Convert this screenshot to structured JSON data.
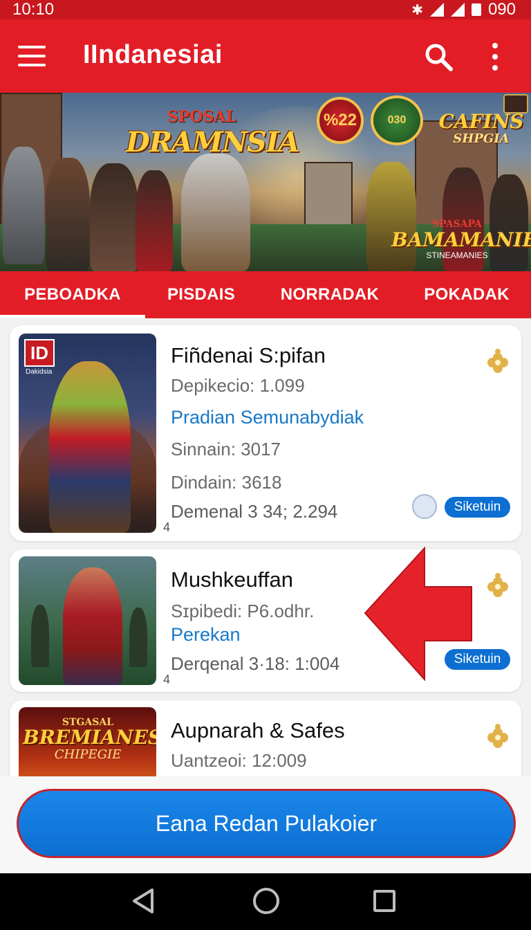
{
  "status_bar": {
    "time": "10:10",
    "battery_text": "090"
  },
  "app_bar": {
    "title": "IIndanesiai"
  },
  "banner": {
    "logo_left_small": "SPOSAL",
    "logo_left_big": "DRAMNSIA",
    "badge_red_text": "%22",
    "badge_green_text": "030",
    "logo_right_big": "CAFINS",
    "logo_right_small": "SHPGIA",
    "logo_bottom_small": "SPASAPA",
    "logo_bottom_big": "BAMAMANIES",
    "logo_bottom_tag": "STINEAMANIES"
  },
  "tabs": [
    {
      "label": "PEBOADKA",
      "active": true
    },
    {
      "label": "PISDAIS",
      "active": false
    },
    {
      "label": "NORRADAK",
      "active": false
    },
    {
      "label": "POKADAK",
      "active": false
    }
  ],
  "cards": [
    {
      "thumb_logo": "ID",
      "thumb_logo_sub": "Dakidsia",
      "title": "Fiñdenai S:pifan",
      "line1": "Depikecio: 1.099",
      "link": "Pradian Semunabydiak",
      "line2": "Sinnain: 3017",
      "line3": "Dindain: 3618",
      "line4": "Demenal 3 34; 2.294",
      "small_num": "4",
      "pill": "Siketuin"
    },
    {
      "title": "Mushkeuffan",
      "line1": "Sɪpibedi: P6.odhr.",
      "link": "Perekan",
      "line4": "Derqenal 3·18: 1:004",
      "small_num": "4",
      "pill": "Siketuin"
    },
    {
      "thumb_small": "STGASAL",
      "thumb_big": "BREMIANES",
      "thumb_sub": "CHIPEGIE",
      "title": "Aupnarah & Safes",
      "line1": "Uantzeoi: 12:009"
    }
  ],
  "cta": {
    "label": "Eana Redan Pulakoier"
  },
  "colors": {
    "primary_red": "#e21d26",
    "accent_blue": "#0c6fd1",
    "link_blue": "#1778c8",
    "gold": "#d9a43c"
  },
  "icons": [
    "menu-icon",
    "search-icon",
    "more-vert-icon",
    "flower-icon",
    "avatar-icon",
    "back-icon",
    "home-icon",
    "recent-apps-icon",
    "bluetooth-icon",
    "signal-icon",
    "battery-icon"
  ]
}
